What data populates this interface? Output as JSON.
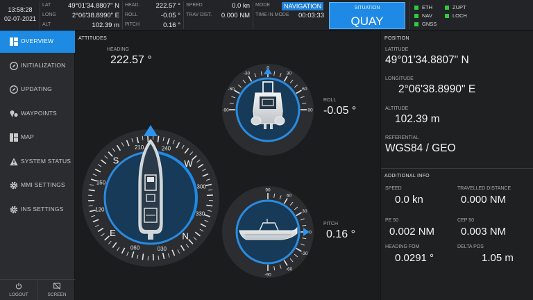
{
  "topbar": {
    "time": "13:58:28",
    "date": "02-07-2021",
    "lat_label": "LAT",
    "lat_value": "49°01'34.8807\" N",
    "long_label": "LONG",
    "long_value": "2°06'38.8990\" E",
    "alt_label": "ALT",
    "alt_value": "102.39 m",
    "head_label": "HEAD.",
    "head_value": "222.57 °",
    "roll_label": "ROLL",
    "roll_value": "-0.05 °",
    "pitch_label": "PITCH",
    "pitch_value": "0.16 °",
    "speed_label": "SPEED",
    "speed_value": "0.0 kn",
    "trav_label": "TRAV DIST.",
    "trav_value": "0.000 NM",
    "mode_label": "MODE",
    "mode_value": "NAVIGATION",
    "tim_label": "TIME IN MODE",
    "tim_value": "00:03:33",
    "situation_label": "SITUATION",
    "situation_value": "QUAY",
    "indicators": [
      {
        "label": "ETH",
        "color": "#2ecc40"
      },
      {
        "label": "ZUPT",
        "color": "#2ecc40"
      },
      {
        "label": "NAV",
        "color": "#2ecc40"
      },
      {
        "label": "LOCH",
        "color": "#2ecc40"
      },
      {
        "label": "GNSS",
        "color": "#2ecc40"
      }
    ]
  },
  "sidebar": {
    "items": [
      {
        "label": "OVERVIEW",
        "icon": "dashboard-icon",
        "active": true
      },
      {
        "label": "INITIALIZATION",
        "icon": "compass-icon",
        "active": false
      },
      {
        "label": "UPDATING",
        "icon": "compass-icon",
        "active": false
      },
      {
        "label": "WAYPOINTS",
        "icon": "waypoints-icon",
        "active": false
      },
      {
        "label": "MAP",
        "icon": "map-icon",
        "active": false
      },
      {
        "label": "SYSTEM STATUS",
        "icon": "warning-icon",
        "active": false
      },
      {
        "label": "MMI SETTINGS",
        "icon": "gear-icon",
        "active": false
      },
      {
        "label": "INS SETTINGS",
        "icon": "gear-icon",
        "active": false
      }
    ],
    "logout_label": "LOGOUT",
    "screen_label": "SCREEN"
  },
  "attitudes": {
    "title": "ATTITUDES",
    "heading_label": "HEADING",
    "heading_value": "222.57 °",
    "heading_deg": 222.57,
    "roll_label": "ROLL",
    "roll_value": "-0.05 °",
    "roll_deg": -0.05,
    "pitch_label": "PITCH",
    "pitch_value": "0.16 °",
    "pitch_deg": 0.16,
    "compass_labels": [
      "S",
      "W",
      "N",
      "E"
    ],
    "compass_numbers": [
      "210",
      "240",
      "300",
      "330",
      "030",
      "060",
      "120",
      "150"
    ],
    "roll_scale": [
      "-90",
      "-60",
      "-30",
      "0",
      "30",
      "60",
      "90"
    ],
    "pitch_scale": [
      "90",
      "60",
      "30",
      "0",
      "-30",
      "-60",
      "-90"
    ],
    "accent_color": "#1e8ae6"
  },
  "position": {
    "title": "POSITION",
    "latitude_label": "LATITUDE",
    "latitude_value": "49°01'34.8807\" N",
    "longitude_label": "LONGITUDE",
    "longitude_value": "2°06'38.8990\" E",
    "altitude_label": "ALTITUDE",
    "altitude_value": "102.39 m",
    "referential_label": "REFERENTIAL",
    "referential_value": "WGS84 / GEO"
  },
  "additional": {
    "title": "ADDITIONAL INFO",
    "speed_label": "SPEED",
    "speed_value": "0.0 kn",
    "trav_label": "TRAVELLED DISTANCE",
    "trav_value": "0.000 NM",
    "pe50_label": "PE 50",
    "pe50_value": "0.002 NM",
    "cep50_label": "CEP 50",
    "cep50_value": "0.003 NM",
    "hfom_label": "HEADING FOM",
    "hfom_value": "0.0291 °",
    "delta_label": "DELTA POS",
    "delta_value": "1.05 m"
  }
}
